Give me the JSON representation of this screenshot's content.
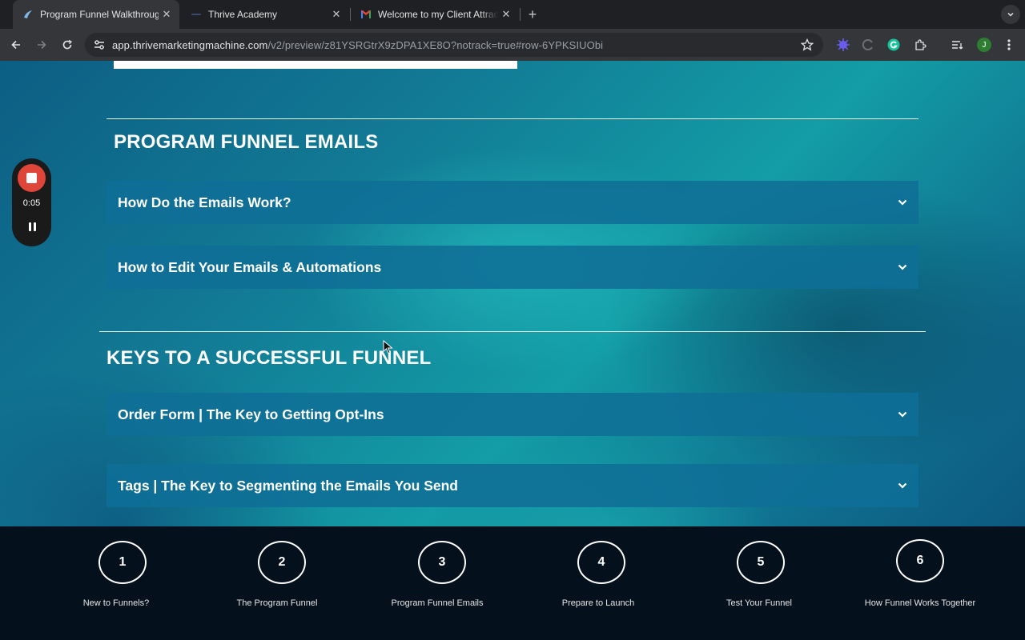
{
  "browser": {
    "tabs": [
      {
        "title": "Program Funnel Walkthrough",
        "active": true
      },
      {
        "title": "Thrive Academy",
        "active": false
      },
      {
        "title": "Welcome to my Client Attract",
        "active": false
      }
    ],
    "url_host": "app.thrivemarketingmachine.com",
    "url_path": "/v2/preview/z81YSRGtrX9zDPA1XE8O?notrack=true#row-6YPKSIUObi",
    "profile_initial": "J"
  },
  "recorder": {
    "time": "0:05"
  },
  "sections": [
    {
      "title": "PROGRAM FUNNEL EMAILS",
      "items": [
        "How Do the Emails Work?",
        "How to Edit Your Emails & Automations"
      ]
    },
    {
      "title": "KEYS TO A SUCCESSFUL FUNNEL",
      "items": [
        "Order Form | The Key to Getting Opt-Ins",
        "Tags | The Key to Segmenting the Emails You Send"
      ]
    }
  ],
  "steps": [
    {
      "number": "1",
      "label": "New to Funnels?"
    },
    {
      "number": "2",
      "label": "The Program Funnel"
    },
    {
      "number": "3",
      "label": "Program Funnel Emails"
    },
    {
      "number": "4",
      "label": "Prepare to Launch"
    },
    {
      "number": "5",
      "label": "Test Your Funnel"
    },
    {
      "number": "6",
      "label": "How Funnel Works Together"
    }
  ],
  "colors": {
    "accordion_bg": "#0f6e96",
    "footer_bg": "#04101c",
    "record_red": "#e0453a"
  }
}
